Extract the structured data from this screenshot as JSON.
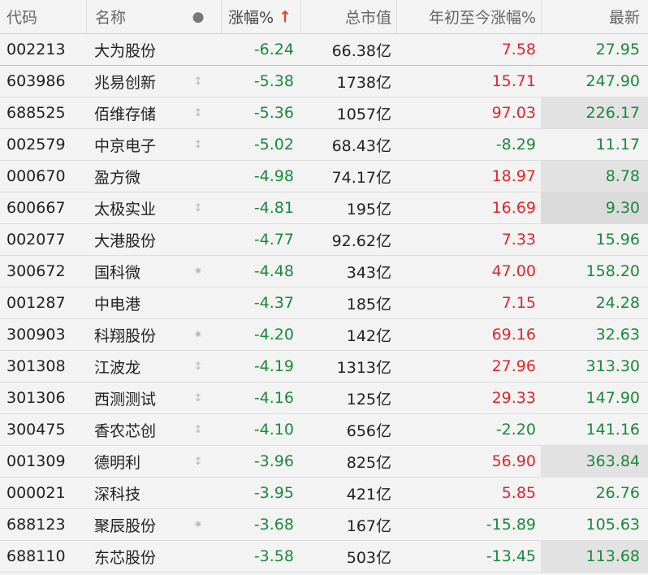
{
  "header": {
    "code": "代码",
    "name": "名称",
    "dot": "●",
    "change": "涨幅%",
    "sort_arrow": "↑",
    "cap": "总市值",
    "ytd": "年初至今涨幅%",
    "last": "最新"
  },
  "icons": {
    "updown": "↕",
    "star": "✷"
  },
  "colors": {
    "up": "#e0272b",
    "down": "#1a8a3a",
    "highlight": "#e2e2e2"
  },
  "rows": [
    {
      "code": "002213",
      "name": "大为股份",
      "icon": "",
      "change": "-6.24",
      "cap": "66.38亿",
      "ytd": "7.58",
      "ytd_dir": "red",
      "last": "27.95",
      "hl": ""
    },
    {
      "code": "603986",
      "name": "兆易创新",
      "icon": "updown",
      "change": "-5.38",
      "cap": "1738亿",
      "ytd": "15.71",
      "ytd_dir": "red",
      "last": "247.90",
      "hl": ""
    },
    {
      "code": "688525",
      "name": "佰维存储",
      "icon": "updown",
      "change": "-5.36",
      "cap": "1057亿",
      "ytd": "97.03",
      "ytd_dir": "red",
      "last": "226.17",
      "hl": "hl"
    },
    {
      "code": "002579",
      "name": "中京电子",
      "icon": "updown",
      "change": "-5.02",
      "cap": "68.43亿",
      "ytd": "-8.29",
      "ytd_dir": "green",
      "last": "11.17",
      "hl": ""
    },
    {
      "code": "000670",
      "name": "盈方微",
      "icon": "",
      "change": "-4.98",
      "cap": "74.17亿",
      "ytd": "18.97",
      "ytd_dir": "red",
      "last": "8.78",
      "hl": "hl"
    },
    {
      "code": "600667",
      "name": "太极实业",
      "icon": "updown",
      "change": "-4.81",
      "cap": "195亿",
      "ytd": "16.69",
      "ytd_dir": "red",
      "last": "9.30",
      "hl": "hl2"
    },
    {
      "code": "002077",
      "name": "大港股份",
      "icon": "",
      "change": "-4.77",
      "cap": "92.62亿",
      "ytd": "7.33",
      "ytd_dir": "red",
      "last": "15.96",
      "hl": ""
    },
    {
      "code": "300672",
      "name": "国科微",
      "icon": "star",
      "change": "-4.48",
      "cap": "343亿",
      "ytd": "47.00",
      "ytd_dir": "red",
      "last": "158.20",
      "hl": ""
    },
    {
      "code": "001287",
      "name": "中电港",
      "icon": "",
      "change": "-4.37",
      "cap": "185亿",
      "ytd": "7.15",
      "ytd_dir": "red",
      "last": "24.28",
      "hl": ""
    },
    {
      "code": "300903",
      "name": "科翔股份",
      "icon": "star",
      "change": "-4.20",
      "cap": "142亿",
      "ytd": "69.16",
      "ytd_dir": "red",
      "last": "32.63",
      "hl": ""
    },
    {
      "code": "301308",
      "name": "江波龙",
      "icon": "updown",
      "change": "-4.19",
      "cap": "1313亿",
      "ytd": "27.96",
      "ytd_dir": "red",
      "last": "313.30",
      "hl": ""
    },
    {
      "code": "301306",
      "name": "西测测试",
      "icon": "updown",
      "change": "-4.16",
      "cap": "125亿",
      "ytd": "29.33",
      "ytd_dir": "red",
      "last": "147.90",
      "hl": ""
    },
    {
      "code": "300475",
      "name": "香农芯创",
      "icon": "updown",
      "change": "-4.10",
      "cap": "656亿",
      "ytd": "-2.20",
      "ytd_dir": "green",
      "last": "141.16",
      "hl": ""
    },
    {
      "code": "001309",
      "name": "德明利",
      "icon": "updown",
      "change": "-3.96",
      "cap": "825亿",
      "ytd": "56.90",
      "ytd_dir": "red",
      "last": "363.84",
      "hl": "hl"
    },
    {
      "code": "000021",
      "name": "深科技",
      "icon": "",
      "change": "-3.95",
      "cap": "421亿",
      "ytd": "5.85",
      "ytd_dir": "red",
      "last": "26.76",
      "hl": ""
    },
    {
      "code": "688123",
      "name": "聚辰股份",
      "icon": "star",
      "change": "-3.68",
      "cap": "167亿",
      "ytd": "-15.89",
      "ytd_dir": "green",
      "last": "105.63",
      "hl": ""
    },
    {
      "code": "688110",
      "name": "东芯股份",
      "icon": "",
      "change": "-3.58",
      "cap": "503亿",
      "ytd": "-13.45",
      "ytd_dir": "green",
      "last": "113.68",
      "hl": "hl"
    }
  ]
}
